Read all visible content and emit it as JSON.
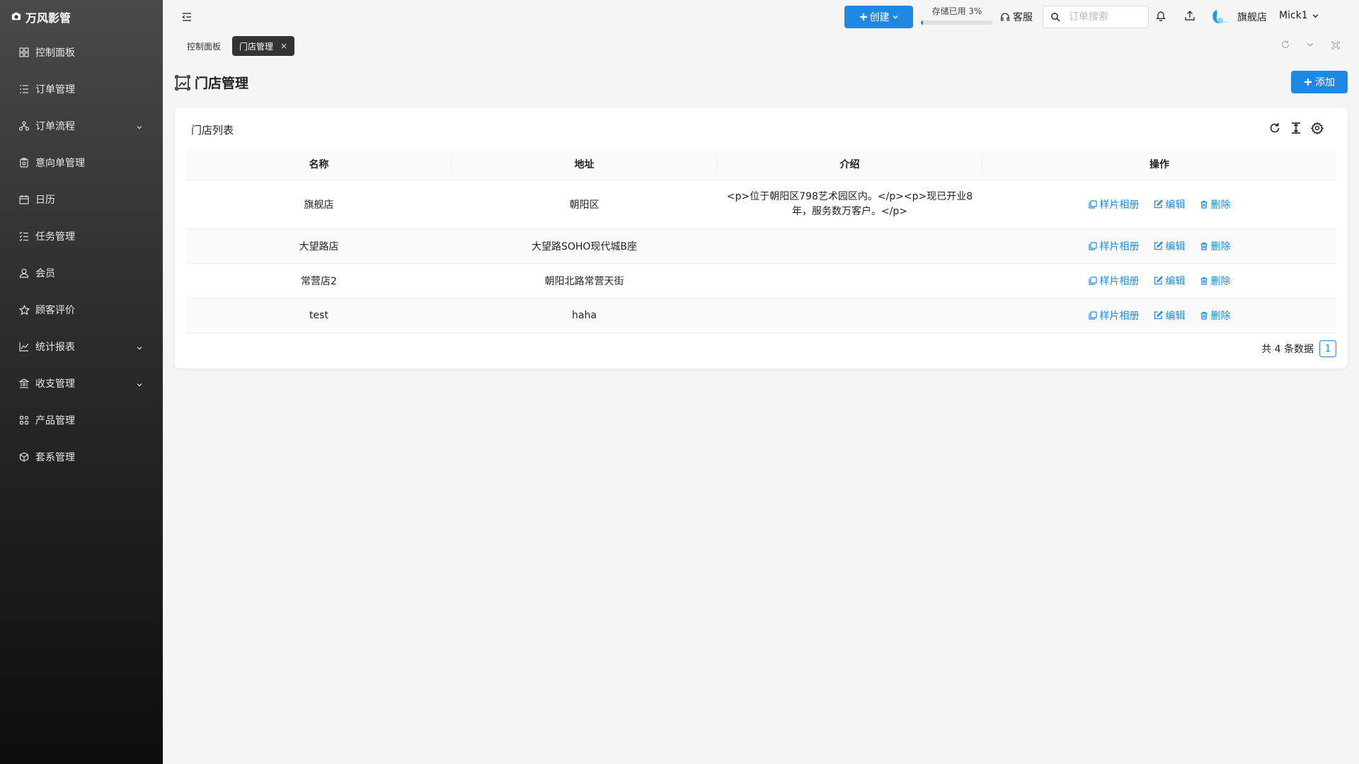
{
  "app": {
    "title": "万风影管"
  },
  "sidebar": {
    "items": [
      {
        "label": "控制面板"
      },
      {
        "label": "订单管理"
      },
      {
        "label": "订单流程"
      },
      {
        "label": "意向单管理"
      },
      {
        "label": "日历"
      },
      {
        "label": "任务管理"
      },
      {
        "label": "会员"
      },
      {
        "label": "顾客评价"
      },
      {
        "label": "统计报表"
      },
      {
        "label": "收支管理"
      },
      {
        "label": "产品管理"
      },
      {
        "label": "套系管理"
      }
    ]
  },
  "topbar": {
    "create_label": "创建",
    "storage_text": "存储已用 3%",
    "storage_percent": 3,
    "service_label": "客服",
    "search_placeholder": "订单搜索",
    "store_name": "旗舰店",
    "user_name": "Mick1"
  },
  "tabs": [
    {
      "label": "控制面板"
    },
    {
      "label": "门店管理"
    }
  ],
  "page": {
    "title": "门店管理",
    "add_label": "添加"
  },
  "card": {
    "title": "门店列表",
    "columns": [
      "名称",
      "地址",
      "介绍",
      "操作"
    ],
    "rows": [
      {
        "name": "旗舰店",
        "address": "朝阳区",
        "intro": "<p>位于朝阳区798艺术园区内。</p><p>现已开业8年，服务数万客户。</p>"
      },
      {
        "name": "大望路店",
        "address": "大望路SOHO现代城B座",
        "intro": ""
      },
      {
        "name": "常营店2",
        "address": "朝阳北路常营天街",
        "intro": ""
      },
      {
        "name": "test",
        "address": "haha",
        "intro": ""
      }
    ],
    "actions": {
      "album": "样片相册",
      "edit": "编辑",
      "delete": "删除"
    },
    "total_text": "共 4 条数据",
    "current_page": "1"
  },
  "colors": {
    "primary": "#1e88e5",
    "sidebar_bg": "#2e2e2e"
  }
}
